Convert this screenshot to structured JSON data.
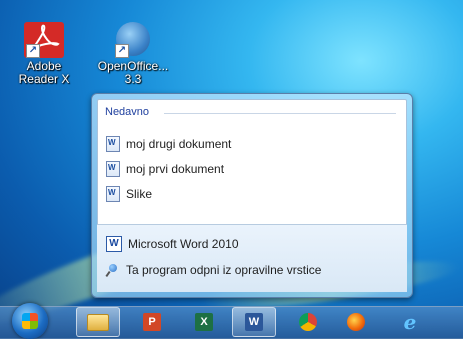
{
  "desktop": {
    "icons": [
      {
        "label_line1": "Adobe",
        "label_line2": "Reader X",
        "icon": "adobe-reader-icon"
      },
      {
        "label_line1": "OpenOffice...",
        "label_line2": "3.3",
        "icon": "openoffice-icon"
      }
    ]
  },
  "jumplist": {
    "section_header": "Nedavno",
    "recent_items": [
      {
        "label": "moj drugi dokument",
        "icon": "word-document-icon"
      },
      {
        "label": "moj prvi dokument",
        "icon": "word-document-icon"
      },
      {
        "label": "Slike",
        "icon": "word-document-icon"
      }
    ],
    "app_item": {
      "label": "Microsoft Word 2010",
      "icon": "word-icon"
    },
    "unpin_item": {
      "label": "Ta program odpni iz opravilne vrstice",
      "icon": "unpin-icon"
    }
  },
  "taskbar": {
    "buttons": [
      {
        "name": "explorer",
        "icon": "folder-icon",
        "glyph": ""
      },
      {
        "name": "powerpoint",
        "icon": "powerpoint-icon",
        "glyph": "P",
        "color": "#d24726"
      },
      {
        "name": "excel",
        "icon": "excel-icon",
        "glyph": "X",
        "color": "#1d7044"
      },
      {
        "name": "word",
        "icon": "word-icon",
        "glyph": "W",
        "color": "#2b579a"
      },
      {
        "name": "chrome",
        "icon": "chrome-icon",
        "glyph": ""
      },
      {
        "name": "firefox",
        "icon": "firefox-icon",
        "glyph": ""
      },
      {
        "name": "internet-explorer",
        "icon": "ie-icon",
        "glyph": "e",
        "color": "#1ea1f2"
      }
    ]
  }
}
